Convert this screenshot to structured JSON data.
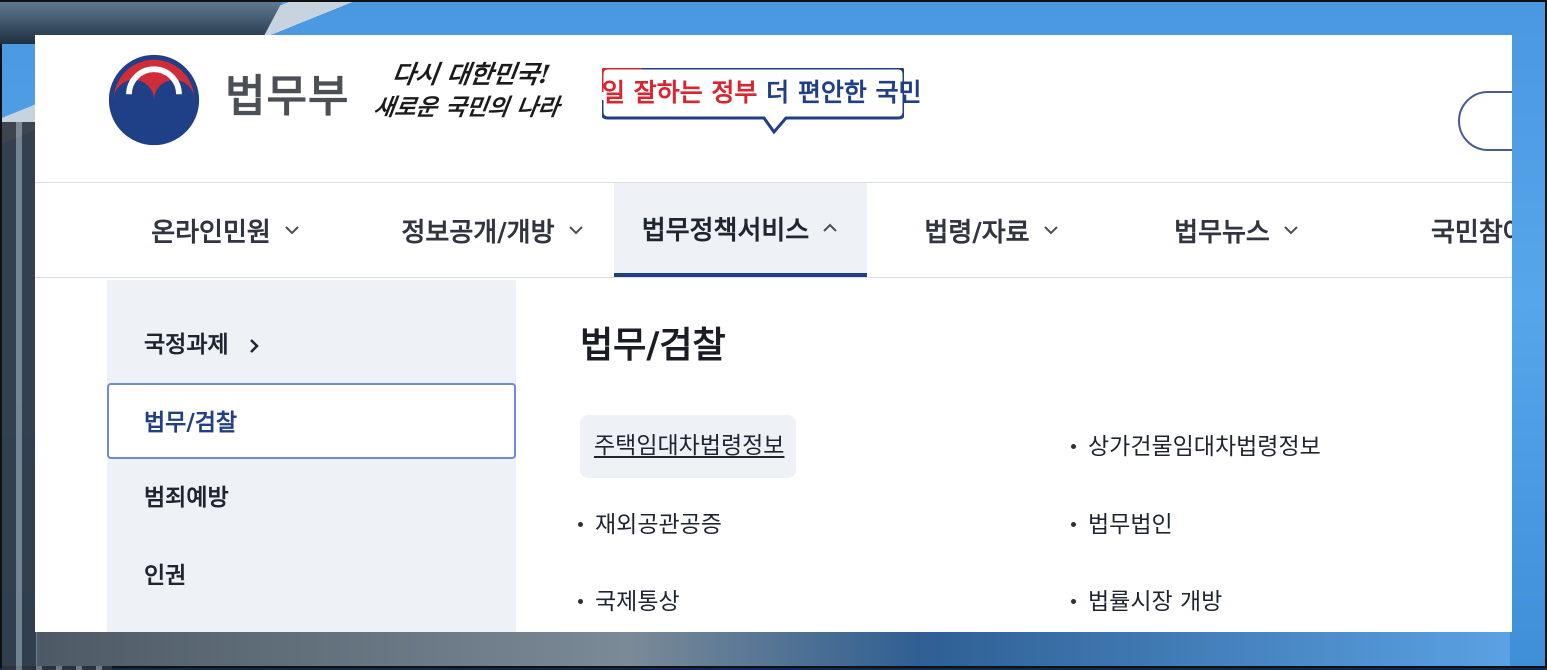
{
  "header": {
    "agency_name": "법무부",
    "slogan_line1": "다시 대한민국!",
    "slogan_line2": "새로운 국민의 나라",
    "campaign_red": "일 잘하는 정부",
    "campaign_blue": "더 편안한 국민"
  },
  "nav": {
    "items": [
      {
        "label": "온라인민원"
      },
      {
        "label": "정보공개/개방"
      },
      {
        "label": "법무정책서비스"
      },
      {
        "label": "법령/자료"
      },
      {
        "label": "법무뉴스"
      },
      {
        "label": "국민참여"
      }
    ],
    "active_index": 2
  },
  "submenu": {
    "items": [
      {
        "label": "국정과제"
      },
      {
        "label": "법무/검찰"
      },
      {
        "label": "범죄예방"
      },
      {
        "label": "인권"
      }
    ],
    "selected_index": 1
  },
  "content": {
    "title": "법무/검찰",
    "links": [
      {
        "label": "주택임대차법령정보"
      },
      {
        "label": "상가건물임대차법령정보"
      },
      {
        "label": "재외공관공증"
      },
      {
        "label": "법무법인"
      },
      {
        "label": "국제통상"
      },
      {
        "label": "법률시장 개방"
      }
    ]
  },
  "colors": {
    "brand_navy": "#223f86",
    "brand_red": "#d9252f",
    "submenu_bg": "#eef1f6",
    "selected_border": "#6f88d8"
  },
  "icons": {
    "logo": "taegeuk-logo-icon",
    "nav_chevron": "chevron-down-icon",
    "nav_active_chevron": "chevron-up-icon",
    "submenu_arrow": "chevron-right-icon"
  }
}
